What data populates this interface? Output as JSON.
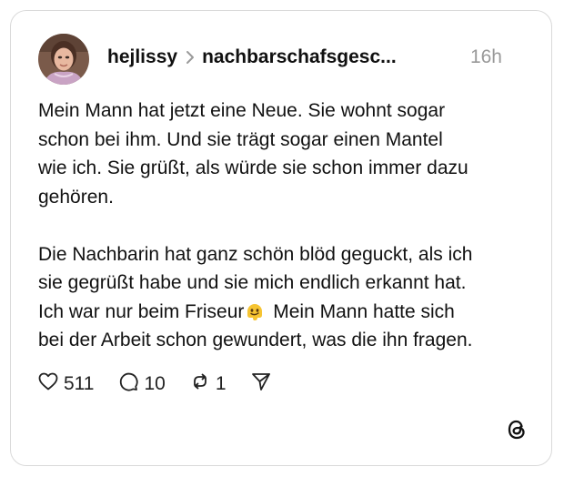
{
  "post": {
    "author": "hejlissy",
    "community": "nachbarschafsgesc...",
    "timestamp": "16h",
    "paragraph_1_before_emoji": "Mein Mann hat jetzt eine Neue. Sie wohnt sogar\nschon bei ihm. Und sie trägt sogar einen Mantel\nwie ich. Sie grüßt, als würde sie schon immer dazu\ngehören.",
    "paragraph_2_before_emoji": "Die Nachbarin hat ganz schön blöd geguckt, als ich\nsie gegrüßt habe und sie mich endlich erkannt hat.\nIch war nur beim Friseur",
    "emoji": "melting-face-emoji",
    "paragraph_2_after_emoji": "Mein Mann hatte sich\nbei der Arbeit schon gewundert, was die ihn fragen."
  },
  "actions": {
    "likes": "511",
    "replies": "10",
    "reposts": "1"
  },
  "icons": {
    "like": "heart-icon",
    "reply": "speech-bubble-icon",
    "repost": "repost-icon",
    "share": "send-icon",
    "separator": "chevron-right-icon",
    "brand": "threads-logo-icon"
  },
  "colors": {
    "card_border": "#d9d9d9",
    "text": "#111111",
    "muted": "#999999",
    "emoji_yellow": "#f6c432"
  }
}
